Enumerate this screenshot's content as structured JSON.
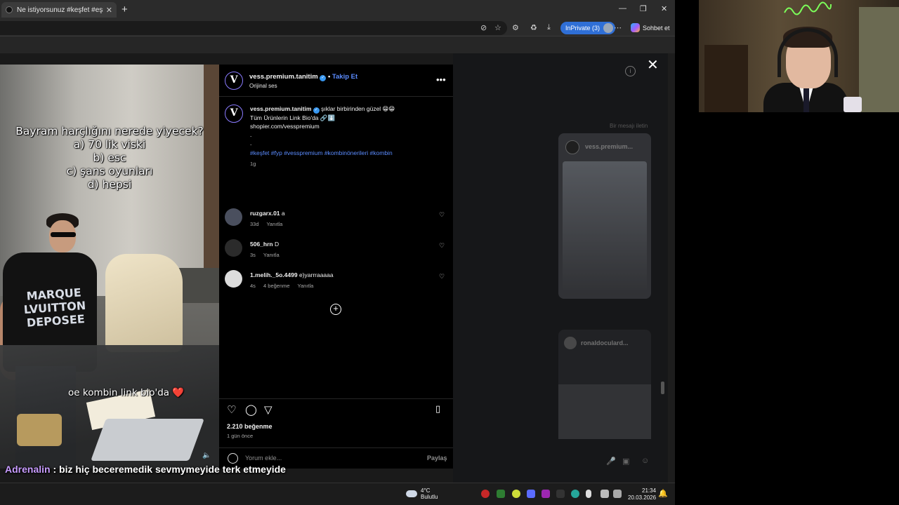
{
  "browser": {
    "tab_title": "Ne istiyorsunuz #keşfet #eşreftek",
    "tab_close": "✕",
    "new_tab": "+",
    "inprivate_label": "InPrivate (3)",
    "sohbet_label": "Sohbet et"
  },
  "post": {
    "username": "vess.premium.tanitim",
    "follow_label": "Takip Et",
    "audio": "Orijinal ses",
    "caption_text": "şıklar birbirinden güzel 😁😁",
    "caption_line2": "Tüm Ürünlerin Link Bio'da 🔗⬇️",
    "caption_line3": "shopier.com/vesspremium",
    "caption_dots": ".",
    "hashtags": "#keşfet #fyp #vesspremium #kombinönerileri #kombin",
    "caption_time": "1g",
    "comments": [
      {
        "user": "ruzgarx.01",
        "text": "a",
        "time": "33d",
        "reply": "Yanıtla"
      },
      {
        "user": "506_hrn",
        "text": "D",
        "time": "3s",
        "reply": "Yanıtla"
      },
      {
        "user": "1.melih._5o.4499",
        "text": "e)yarrraaaaa",
        "time": "4s",
        "likes": "4 beğenme",
        "reply": "Yanıtla"
      }
    ],
    "likes_count": "2.210 beğenme",
    "posted_ago": "1 gün önce",
    "comment_placeholder": "Yorum ekle...",
    "share_label": "Paylaş"
  },
  "video": {
    "overlay_lines": [
      "Bayram harçlığını nerede yiyecek?",
      "a) 70 lik viski",
      "b) esc",
      "c) şans oyunları",
      "d) hepsi"
    ],
    "shirt_text": "MARQUE LVUITTON DEPOSEE",
    "caption": "oe kombin link bio'da ❤️"
  },
  "background": {
    "ghost_user": "vess.premium...",
    "ghost_user2": "ronaldoculard...",
    "ghost_label": "Bir mesajı iletin"
  },
  "chat": {
    "user": "Adrenalin",
    "message": ": biz hiç beceremedik sevmymeyide terk etmeyide"
  },
  "taskbar": {
    "weather_temp": "4°C",
    "weather_desc": "Bulutlu",
    "time": "21:34",
    "date": "20.03.2026"
  },
  "icons": {
    "close": "✕",
    "info": "i",
    "more": "•••",
    "heart": "♡",
    "bookmark": "🔖",
    "add": "+"
  },
  "colors": {
    "accent_blue": "#5b8cff",
    "inprivate_blue": "#2f6fd6",
    "chat_user": "#c89cff"
  }
}
